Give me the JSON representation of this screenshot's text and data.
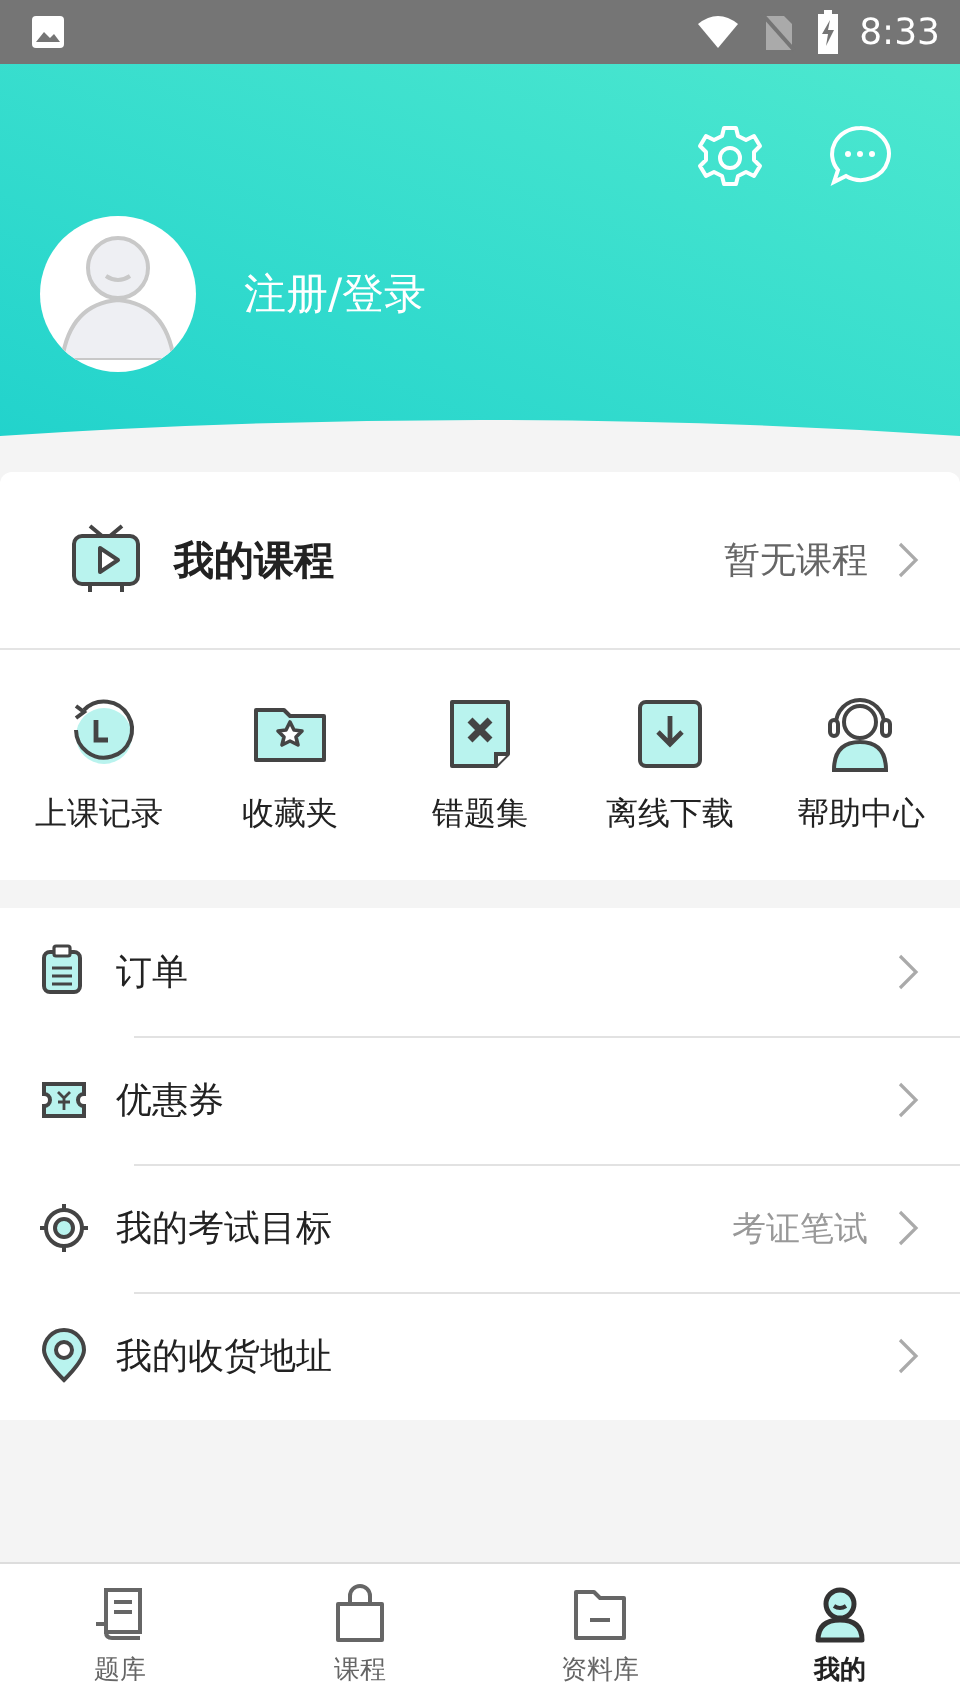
{
  "status_bar": {
    "time": "8:33"
  },
  "profile": {
    "login_label": "注册/登录"
  },
  "course_card": {
    "title": "我的课程",
    "status": "暂无课程"
  },
  "shortcuts": [
    {
      "label": "上课记录"
    },
    {
      "label": "收藏夹"
    },
    {
      "label": "错题集"
    },
    {
      "label": "离线下载"
    },
    {
      "label": "帮助中心"
    }
  ],
  "menu": [
    {
      "label": "订单"
    },
    {
      "label": "优惠券"
    },
    {
      "label": "我的考试目标",
      "value": "考证笔试"
    },
    {
      "label": "我的收货地址"
    }
  ],
  "tab_bar": [
    {
      "label": "题库",
      "selected": false
    },
    {
      "label": "课程",
      "selected": false
    },
    {
      "label": "资料库",
      "selected": false
    },
    {
      "label": "我的",
      "selected": true
    }
  ]
}
